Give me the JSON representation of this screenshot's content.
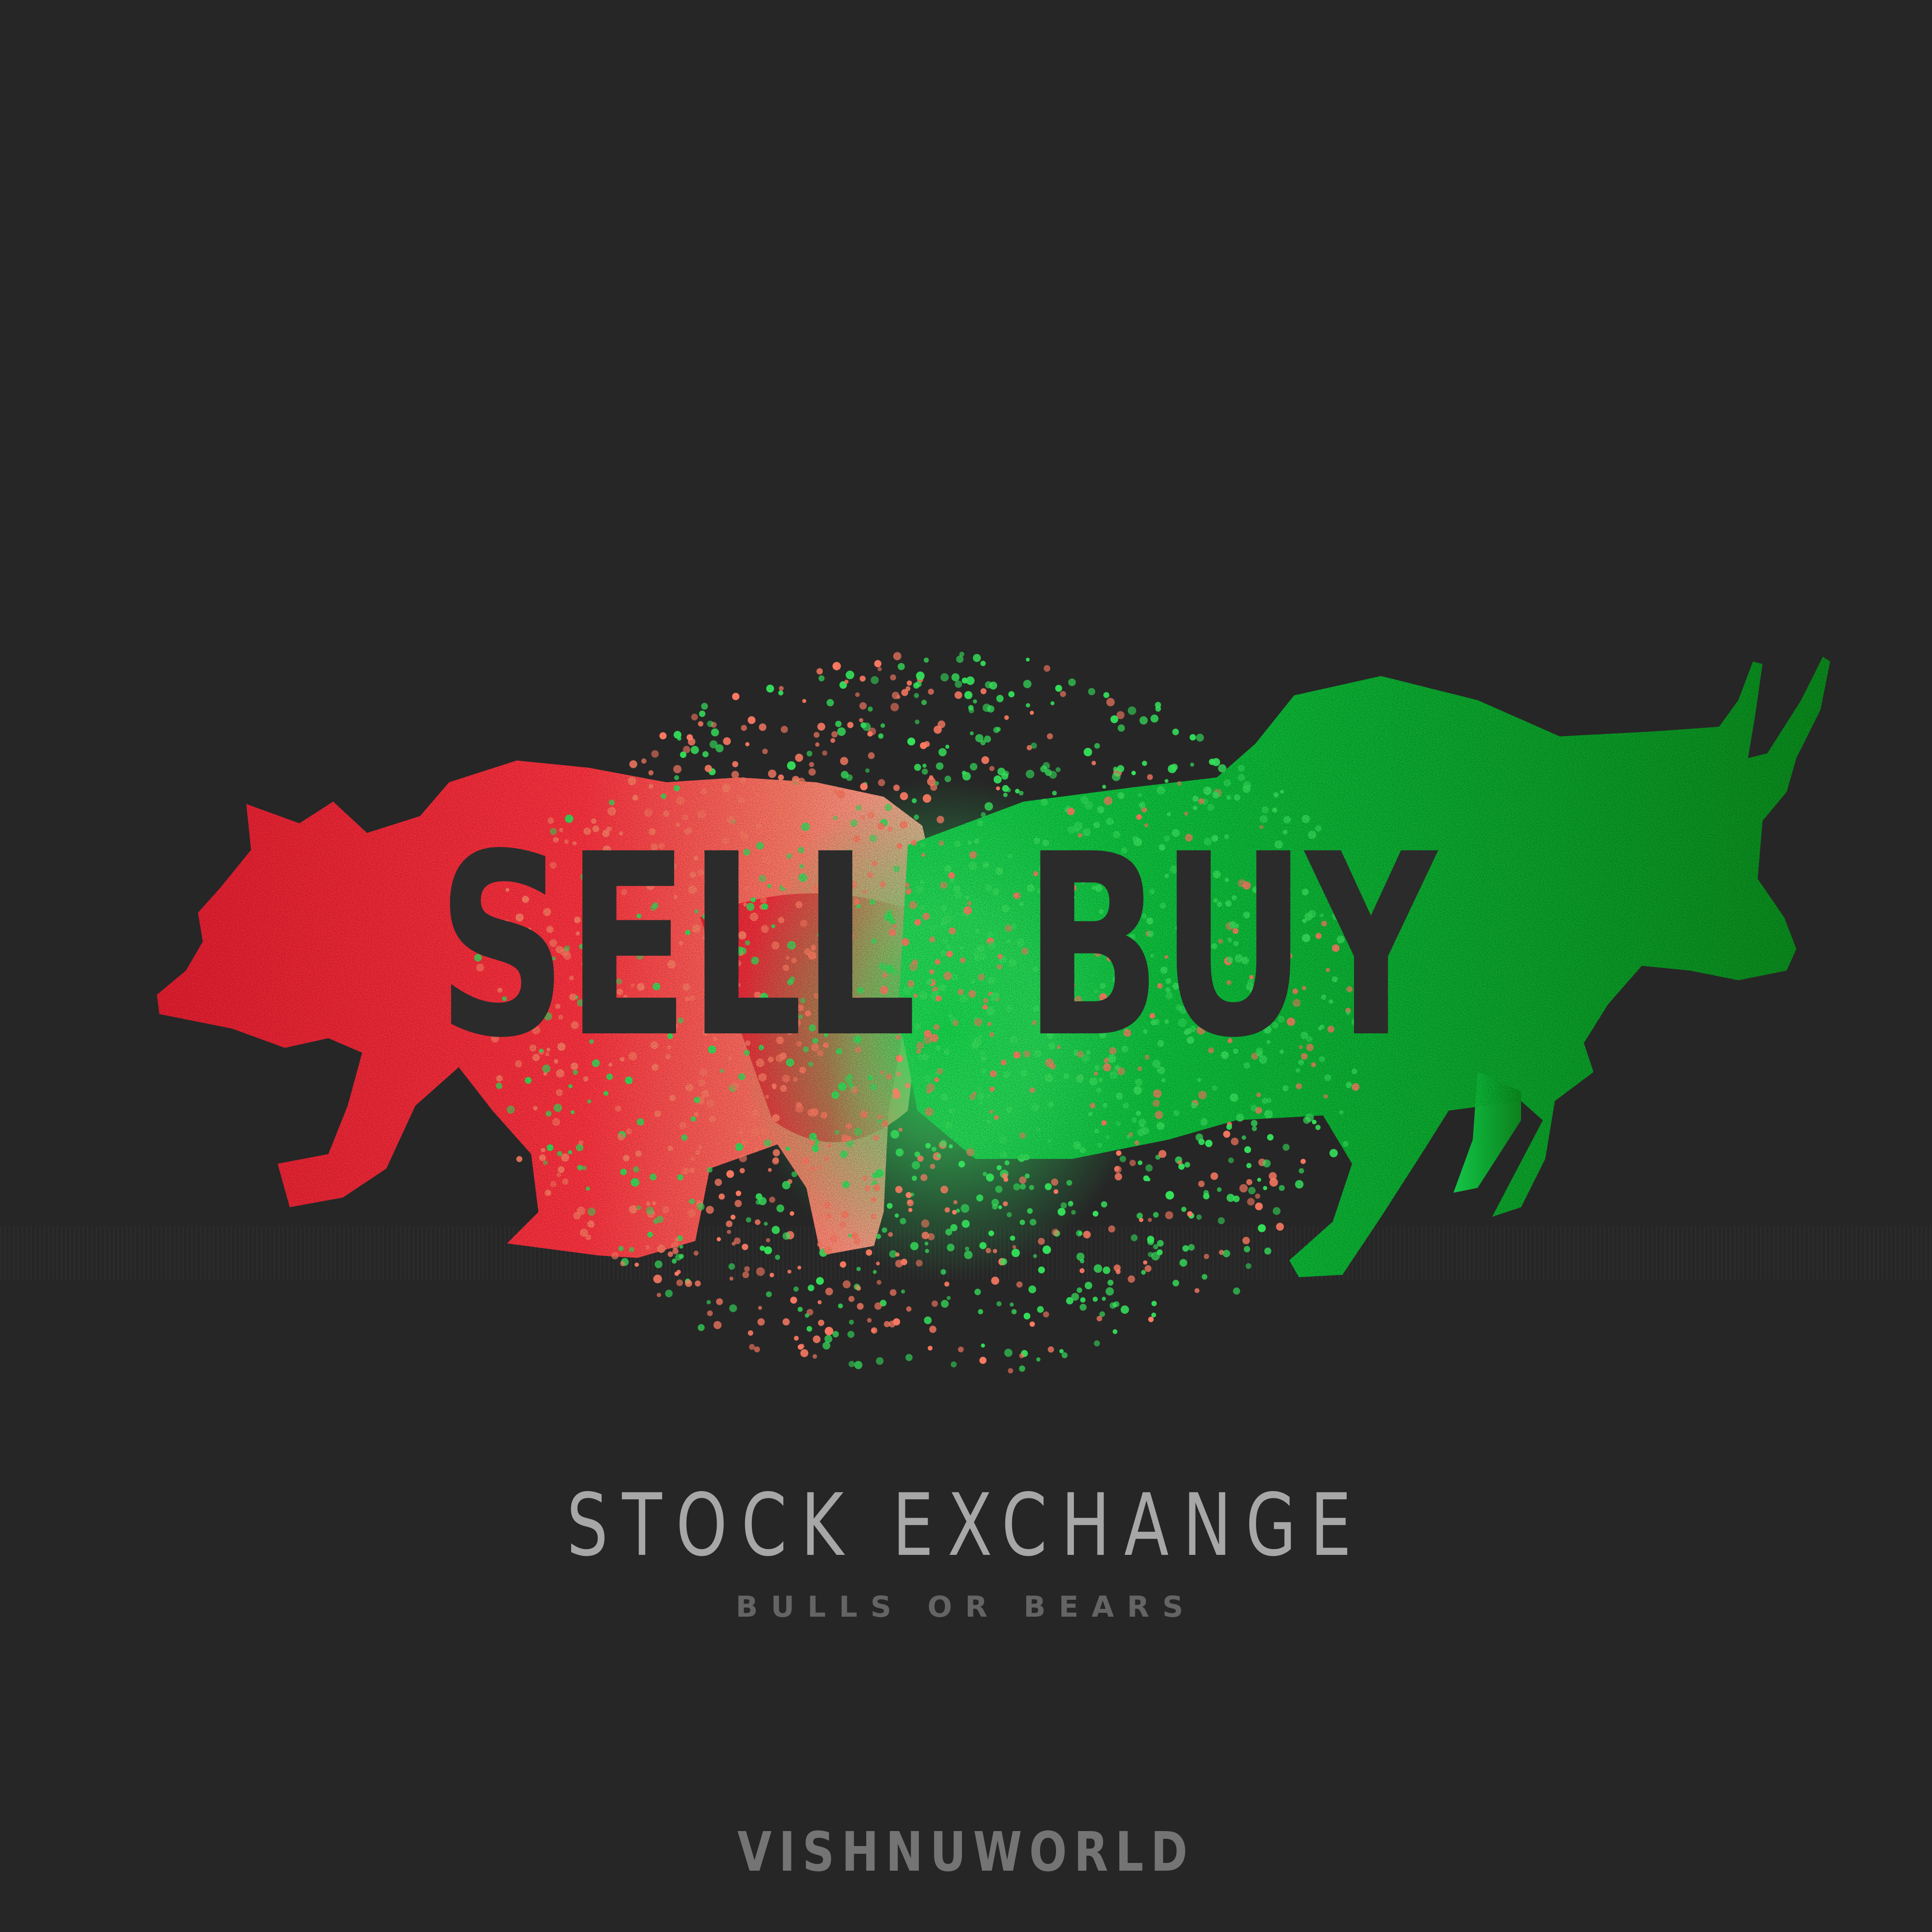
{
  "headline": {
    "left_word": "SELL",
    "right_word": "BUY"
  },
  "title": "STOCK EXCHANGE",
  "subtitle": "BULLS OR BEARS",
  "brand": "VISHNUWORLD",
  "icons": {
    "bear": "bear-silhouette-icon",
    "bull": "bull-silhouette-icon"
  },
  "colors": {
    "background": "#262626",
    "bear": "#ff2b3a",
    "bull": "#10b437",
    "text_dark": "#2b2b2b",
    "title": "#a7a7a7",
    "subtitle": "#646464",
    "brand": "#747474"
  }
}
